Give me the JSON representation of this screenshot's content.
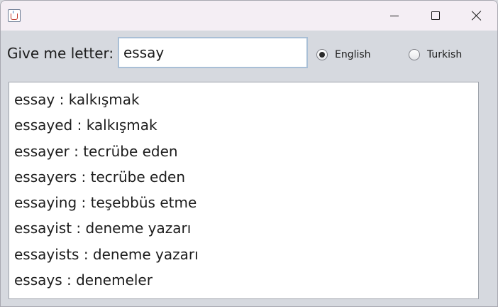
{
  "window": {
    "icon": "java-coffee-icon",
    "controls": {
      "minimize": "minimize-icon",
      "maximize": "maximize-icon",
      "close": "close-icon"
    }
  },
  "form": {
    "label": "Give me letter:",
    "input_value": "essay"
  },
  "language": {
    "options": [
      {
        "label": "English",
        "checked": true
      },
      {
        "label": "Turkish",
        "checked": false
      }
    ]
  },
  "results": [
    "essay : kalkışmak",
    "essayed : kalkışmak",
    "essayer : tecrübe eden",
    "essayers : tecrübe eden",
    "essaying : teşebbüs etme",
    "essayist : deneme yazarı",
    "essayists : deneme yazarı",
    "essays : denemeler"
  ],
  "colors": {
    "title_bar": "#f4eef4",
    "content_bg": "#d6d9df",
    "input_focus_border": "#a9bfd6"
  }
}
